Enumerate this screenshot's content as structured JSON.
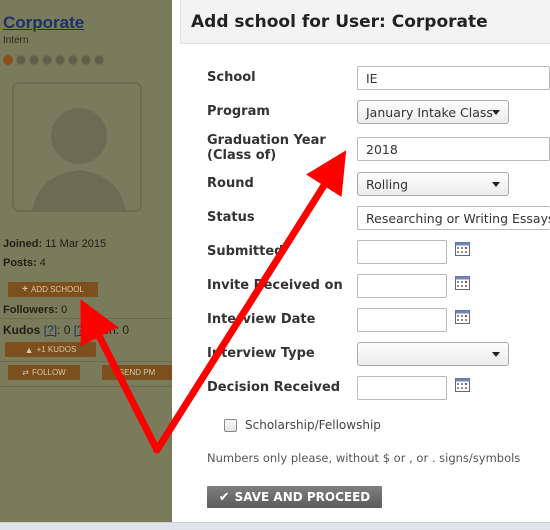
{
  "profile": {
    "username": "Corporate",
    "rank": "Intern",
    "rank_dots_total": 8,
    "rank_dots_filled": 1,
    "joined_label": "Joined:",
    "joined_value": "11 Mar 2015",
    "posts_label": "Posts:",
    "posts_value": "4",
    "add_school_label": "ADD SCHOOL",
    "followers_label": "Followers:",
    "followers_value": "0",
    "kudos_label": "Kudos",
    "kudos_help": "[?]",
    "kudos_received": ": 0",
    "kudos_given_bracket": "[?",
    "kudos_given": "given: 0",
    "plus_kudos_label": "+1 KUDOS",
    "follow_label": "FOLLOW",
    "send_pm_label": "SEND PM"
  },
  "dialog": {
    "title": "Add school for User: Corporate",
    "fields": {
      "school": {
        "label": "School",
        "value": "IE"
      },
      "program": {
        "label": "Program",
        "value": "January Intake Class"
      },
      "graduation_year": {
        "label": "Graduation Year (Class of)",
        "value": "2018"
      },
      "round": {
        "label": "Round",
        "value": "Rolling"
      },
      "status": {
        "label": "Status",
        "value": "Researching or Writing Essays"
      },
      "submitted": {
        "label": "Submitted",
        "value": ""
      },
      "invite_received": {
        "label": "Invite Received on",
        "value": ""
      },
      "interview_date": {
        "label": "Interview Date",
        "value": ""
      },
      "interview_type": {
        "label": "Interview Type",
        "value": ""
      },
      "decision_received": {
        "label": "Decision Received",
        "value": ""
      }
    },
    "scholarship_label": "Scholarship/Fellowship",
    "scholarship_checked": false,
    "hint": "Numbers only please, without $ or , or . signs/symbols",
    "submit_label": "SAVE AND PROCEED"
  },
  "annotation": {
    "arrow_color": "#ff0000"
  },
  "colors": {
    "sidebar_dim": "#7a7b5b",
    "button_brown": "#7d4f1d",
    "link_blue": "#1d2f6c",
    "submit_gray": "#6b6b6b"
  },
  "icons": [
    "calendar-icon",
    "checkmark-icon",
    "thumb-up-icon",
    "plus-icon",
    "caret-down-icon",
    "person-silhouette-icon"
  ]
}
